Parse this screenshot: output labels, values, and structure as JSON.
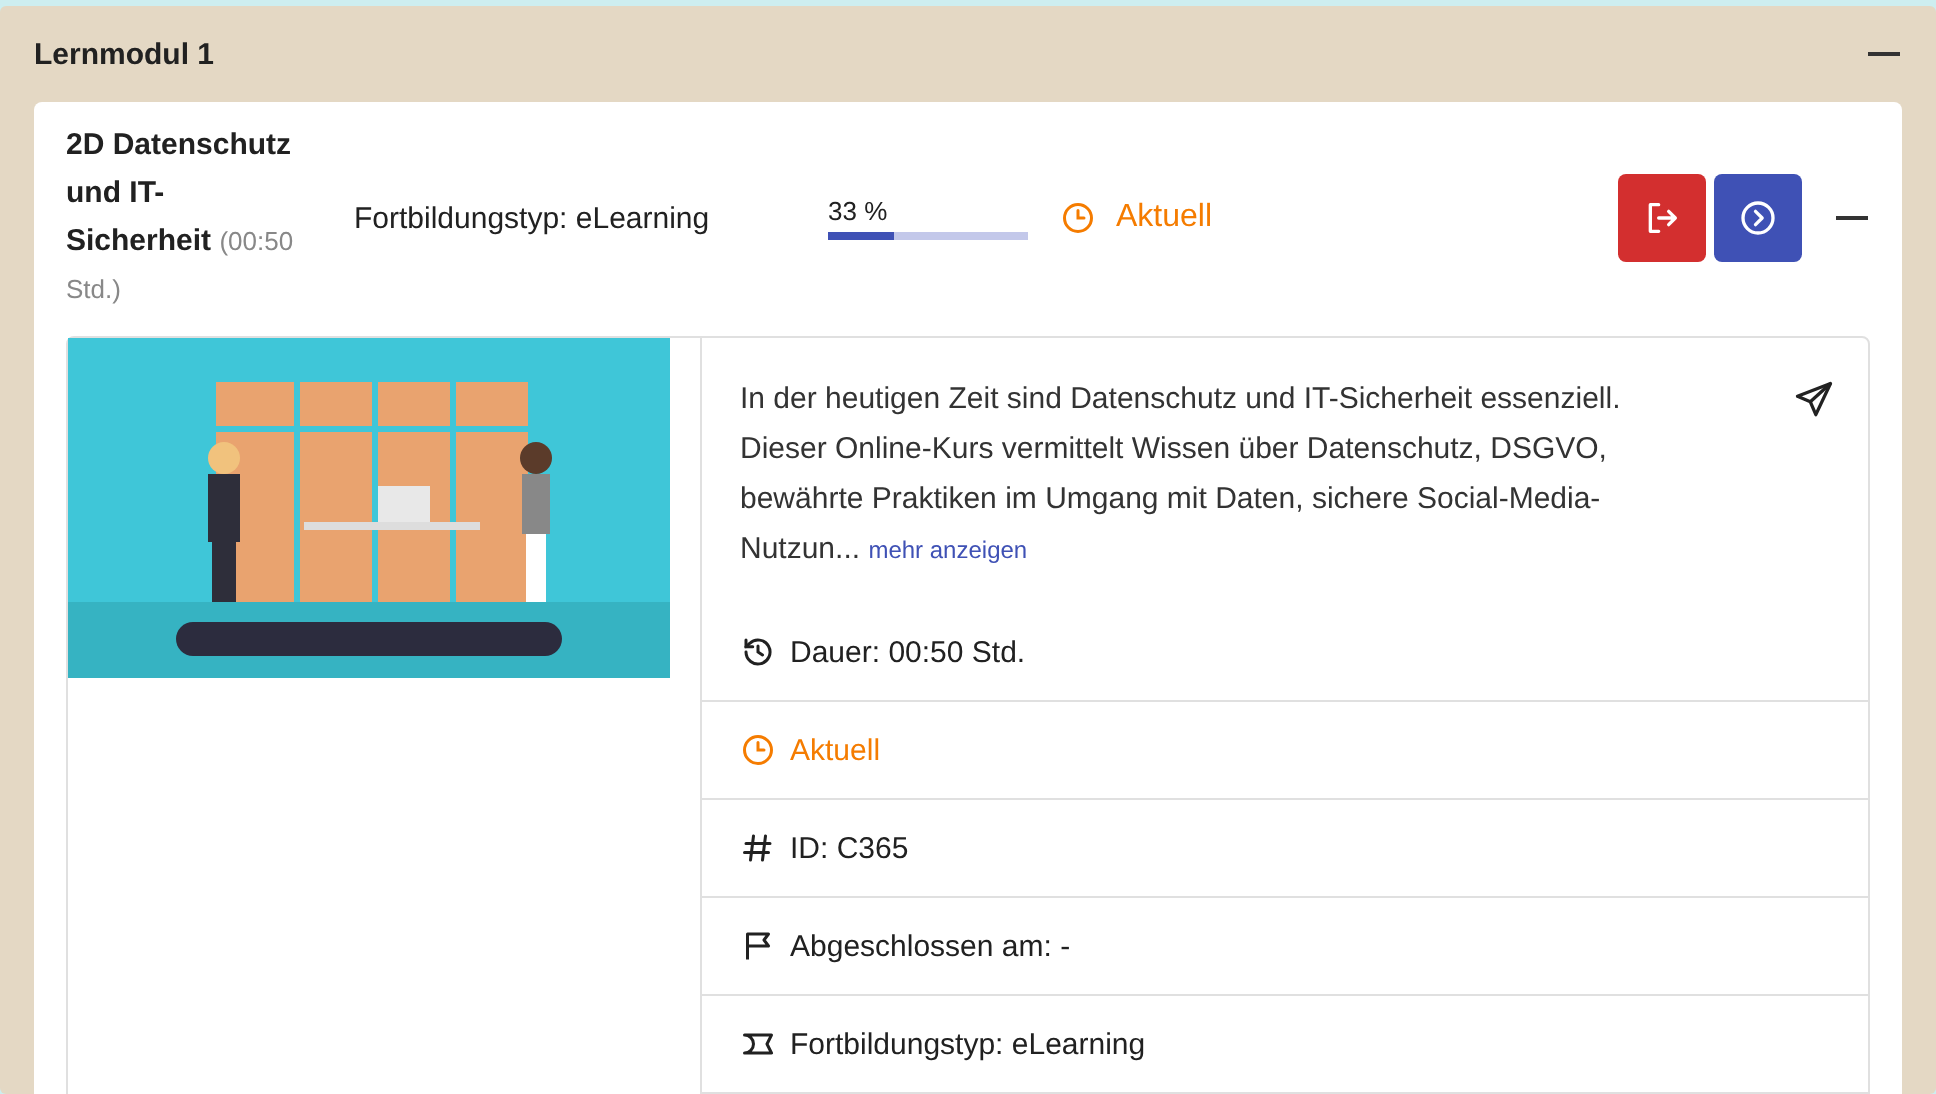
{
  "module": {
    "title": "Lernmodul 1"
  },
  "course": {
    "title": "2D Datenschutz und IT-Sicherheit",
    "duration": "(00:50 Std.)",
    "type": "Fortbildungstyp: eLearning",
    "progress": {
      "label": "33 %",
      "level": 0.33
    },
    "status": "Aktuell",
    "description": "In der heutigen Zeit sind Datenschutz und IT-Sicherheit essenziell. Dieser Online-Kurs vermittelt Wissen über Datenschutz, DSGVO, bewährte Praktiken im Umgang mit Daten, sichere Social-Media-Nutzun...",
    "more_link": "mehr anzeigen",
    "details": [
      {
        "kind": "duration",
        "text": "Dauer: 00:50 Std."
      },
      {
        "kind": "status",
        "text": "Aktuell"
      },
      {
        "kind": "id",
        "text": "ID: C365"
      },
      {
        "kind": "completed",
        "text": "Abgeschlossen am: -"
      },
      {
        "kind": "type",
        "text": "Fortbildungstyp: eLearning"
      }
    ]
  }
}
